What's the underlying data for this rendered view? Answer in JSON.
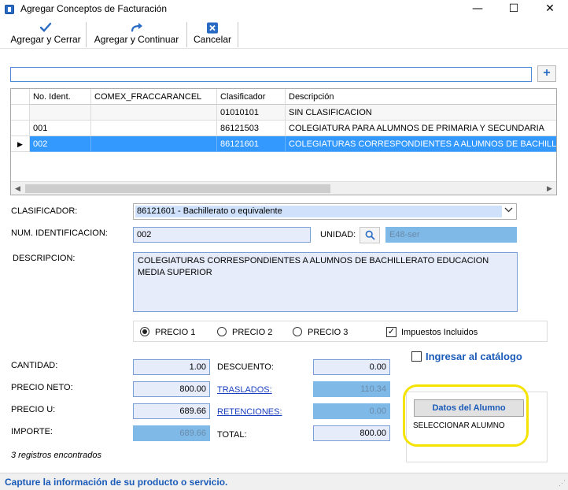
{
  "window": {
    "title": "Agregar Conceptos de Facturación",
    "controls": [
      "—",
      "☐",
      "✕"
    ]
  },
  "toolbar": {
    "buttons": [
      {
        "label": "Agregar y Cerrar",
        "icon": "checkmark-icon"
      },
      {
        "label": "Agregar y Continuar",
        "icon": "forward-arrow-icon"
      },
      {
        "label": "Cancelar",
        "icon": "close-icon"
      }
    ]
  },
  "search": {
    "value": "",
    "add_label": "+"
  },
  "grid": {
    "columns": [
      "No. Ident.",
      "COMEX_FRACCARANCEL",
      "Clasificador",
      "Descripción"
    ],
    "rows": [
      [
        "",
        "",
        "01010101",
        "SIN CLASIFICACION"
      ],
      [
        "001",
        "",
        "86121503",
        "COLEGIATURA PARA ALUMNOS DE PRIMARIA Y SECUNDARIA"
      ],
      [
        "002",
        "",
        "86121601",
        "COLEGIATURAS CORRESPONDIENTES A ALUMNOS DE BACHILLERATO EDUCACION MEDIA SUPERIOR"
      ]
    ],
    "selected_row_index": 2,
    "current_row_marker": "▶"
  },
  "form": {
    "clasificador_label": "CLASIFICADOR:",
    "clasificador_value": "86121601 - Bachillerato o equivalente",
    "num_ident_label": "NUM. IDENTIFICACION:",
    "num_ident_value": "002",
    "unidad_label": "UNIDAD:",
    "unidad_value": "E48-ser",
    "descripcion_label": "DESCRIPCION:",
    "descripcion_value": "COLEGIATURAS CORRESPONDIENTES A ALUMNOS DE BACHILLERATO EDUCACION MEDIA SUPERIOR",
    "precio_options": [
      "PRECIO 1",
      "PRECIO 2",
      "PRECIO 3"
    ],
    "precio_selected": "PRECIO 1",
    "impuestos_label": "Impuestos Incluidos",
    "impuestos_checked": true,
    "ingresar_catalogo_label": "Ingresar al catálogo",
    "ingresar_catalogo_checked": false,
    "cantidad_label": "CANTIDAD:",
    "cantidad_value": "1.00",
    "precio_neto_label": "PRECIO NETO:",
    "precio_neto_value": "800.00",
    "precio_u_label": "PRECIO U:",
    "precio_u_value": "689.66",
    "importe_label": "IMPORTE:",
    "importe_value": "689.66",
    "descuento_label": "DESCUENTO:",
    "descuento_value": "0.00",
    "traslados_label": "TRASLADOS:",
    "traslados_value": "110.34",
    "retenciones_label": "RETENCIONES:",
    "retenciones_value": "0.00",
    "total_label": "TOTAL:",
    "total_value": "800.00"
  },
  "alumno": {
    "button_label": "Datos del Alumno",
    "status_text": "SELECCIONAR ALUMNO"
  },
  "records_label": "3 registros encontrados",
  "status_bar": {
    "message": "Capture la información de su producto o servicio."
  },
  "colors": {
    "selection": "#3399ff",
    "input_bg": "#e6ecfa",
    "readonly_bg": "#7fb9e8",
    "link": "#1a3fbf",
    "accent_blue": "#1a5ab8",
    "highlight": "#f4e400"
  }
}
